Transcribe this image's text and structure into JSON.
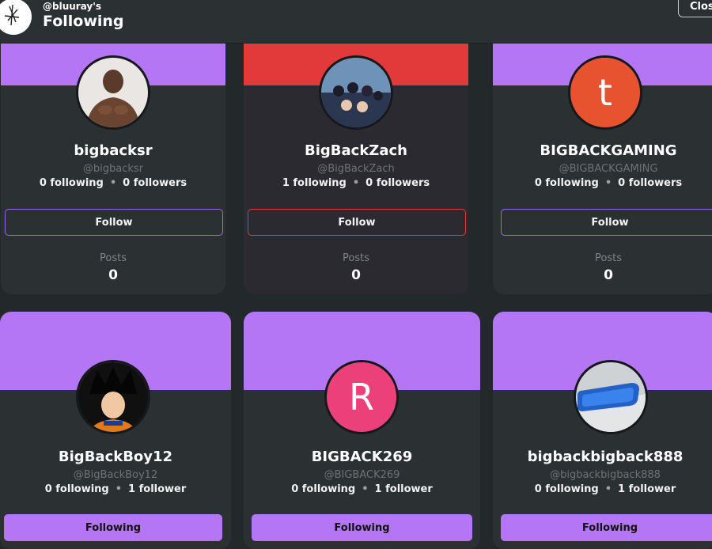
{
  "header": {
    "subtitle": "@bluuray's",
    "title": "Following",
    "close_label": "Close"
  },
  "colors": {
    "accent": "#b476f4",
    "red": "#e2393a",
    "card_bg": "#2b3032"
  },
  "cards": [
    {
      "name": "bigbacksr",
      "handle": "@bigbacksr",
      "following": "0 following",
      "followers": "0 followers",
      "button": "Follow",
      "posts_label": "Posts",
      "posts": "0",
      "avatar_icon": "shirtless-man-photo"
    },
    {
      "name": "BigBackZach",
      "handle": "@BigBackZach",
      "following": "1 following",
      "followers": "0 followers",
      "button": "Follow",
      "posts_label": "Posts",
      "posts": "0",
      "avatar_icon": "anime-group-photo"
    },
    {
      "name": "BIGBACKGAMING",
      "handle": "@BIGBACKGAMING",
      "following": "0 following",
      "followers": "0 followers",
      "button": "Follow",
      "posts_label": "Posts",
      "posts": "0",
      "avatar_letter": "t"
    },
    {
      "name": "BigBackBoy12",
      "handle": "@BigBackBoy12",
      "following": "0 following",
      "followers": "1 follower",
      "button": "Following",
      "avatar_icon": "anime-character-photo"
    },
    {
      "name": "BIGBACK269",
      "handle": "@BIGBACK269",
      "following": "0 following",
      "followers": "1 follower",
      "button": "Following",
      "avatar_letter": "R"
    },
    {
      "name": "bigbackbigback888",
      "handle": "@bigbackbigback888",
      "following": "0 following",
      "followers": "1 follower",
      "button": "Following",
      "avatar_icon": "blue-phone-case-photo"
    }
  ]
}
